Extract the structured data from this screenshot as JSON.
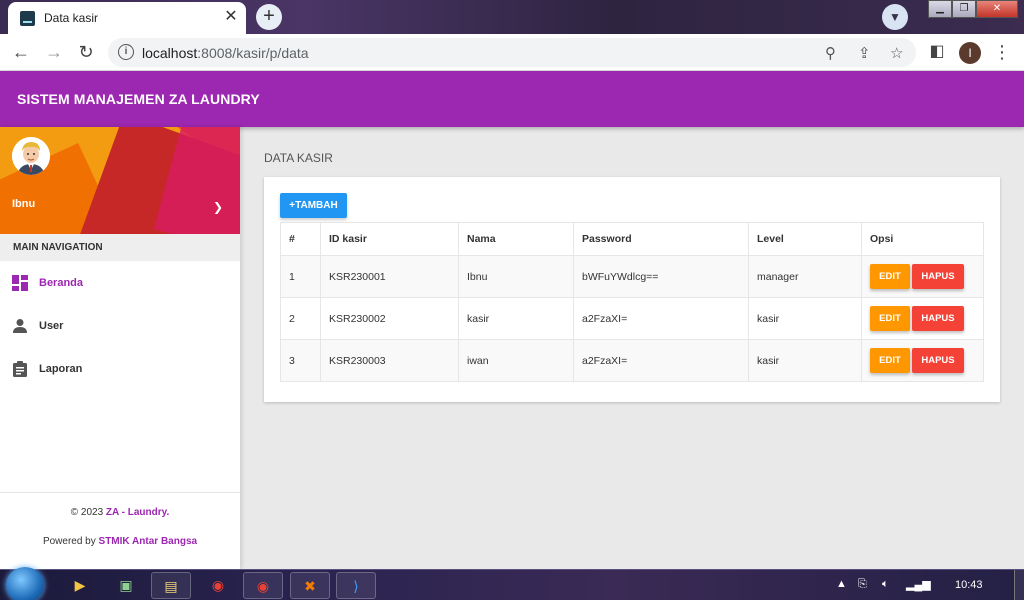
{
  "browser": {
    "tab_title": "Data kasir",
    "url_host": "localhost",
    "url_path": ":8008/kasir/p/data",
    "profile_initial": "I"
  },
  "app": {
    "title": "SISTEM MANAJEMEN ZA LAUNDRY",
    "accent_color": "#9c27b0"
  },
  "sidebar": {
    "user_name": "Ibnu",
    "nav_header": "MAIN NAVIGATION",
    "items": [
      {
        "label": "Beranda",
        "icon": "dashboard-icon",
        "active": true
      },
      {
        "label": "User",
        "icon": "person-icon",
        "active": false
      },
      {
        "label": "Laporan",
        "icon": "clipboard-icon",
        "active": false
      }
    ],
    "footer": {
      "copyright_prefix": "© 2023 ",
      "copyright_brand": "ZA - Laundry.",
      "powered_prefix": "Powered by ",
      "powered_brand": "STMIK Antar Bangsa"
    }
  },
  "content": {
    "page_title": "DATA KASIR",
    "add_button": "+TAMBAH",
    "table": {
      "headers": [
        "#",
        "ID kasir",
        "Nama",
        "Password",
        "Level",
        "Opsi"
      ],
      "rows": [
        {
          "no": "1",
          "id": "KSR230001",
          "nama": "Ibnu",
          "password": "bWFuYWdlcg==",
          "level": "manager"
        },
        {
          "no": "2",
          "id": "KSR230002",
          "nama": "kasir",
          "password": "a2FzaXI=",
          "level": "kasir"
        },
        {
          "no": "3",
          "id": "KSR230003",
          "nama": "iwan",
          "password": "a2FzaXI=",
          "level": "kasir"
        }
      ],
      "edit_label": "EDIT",
      "delete_label": "HAPUS"
    }
  },
  "taskbar": {
    "clock": "10:43"
  }
}
